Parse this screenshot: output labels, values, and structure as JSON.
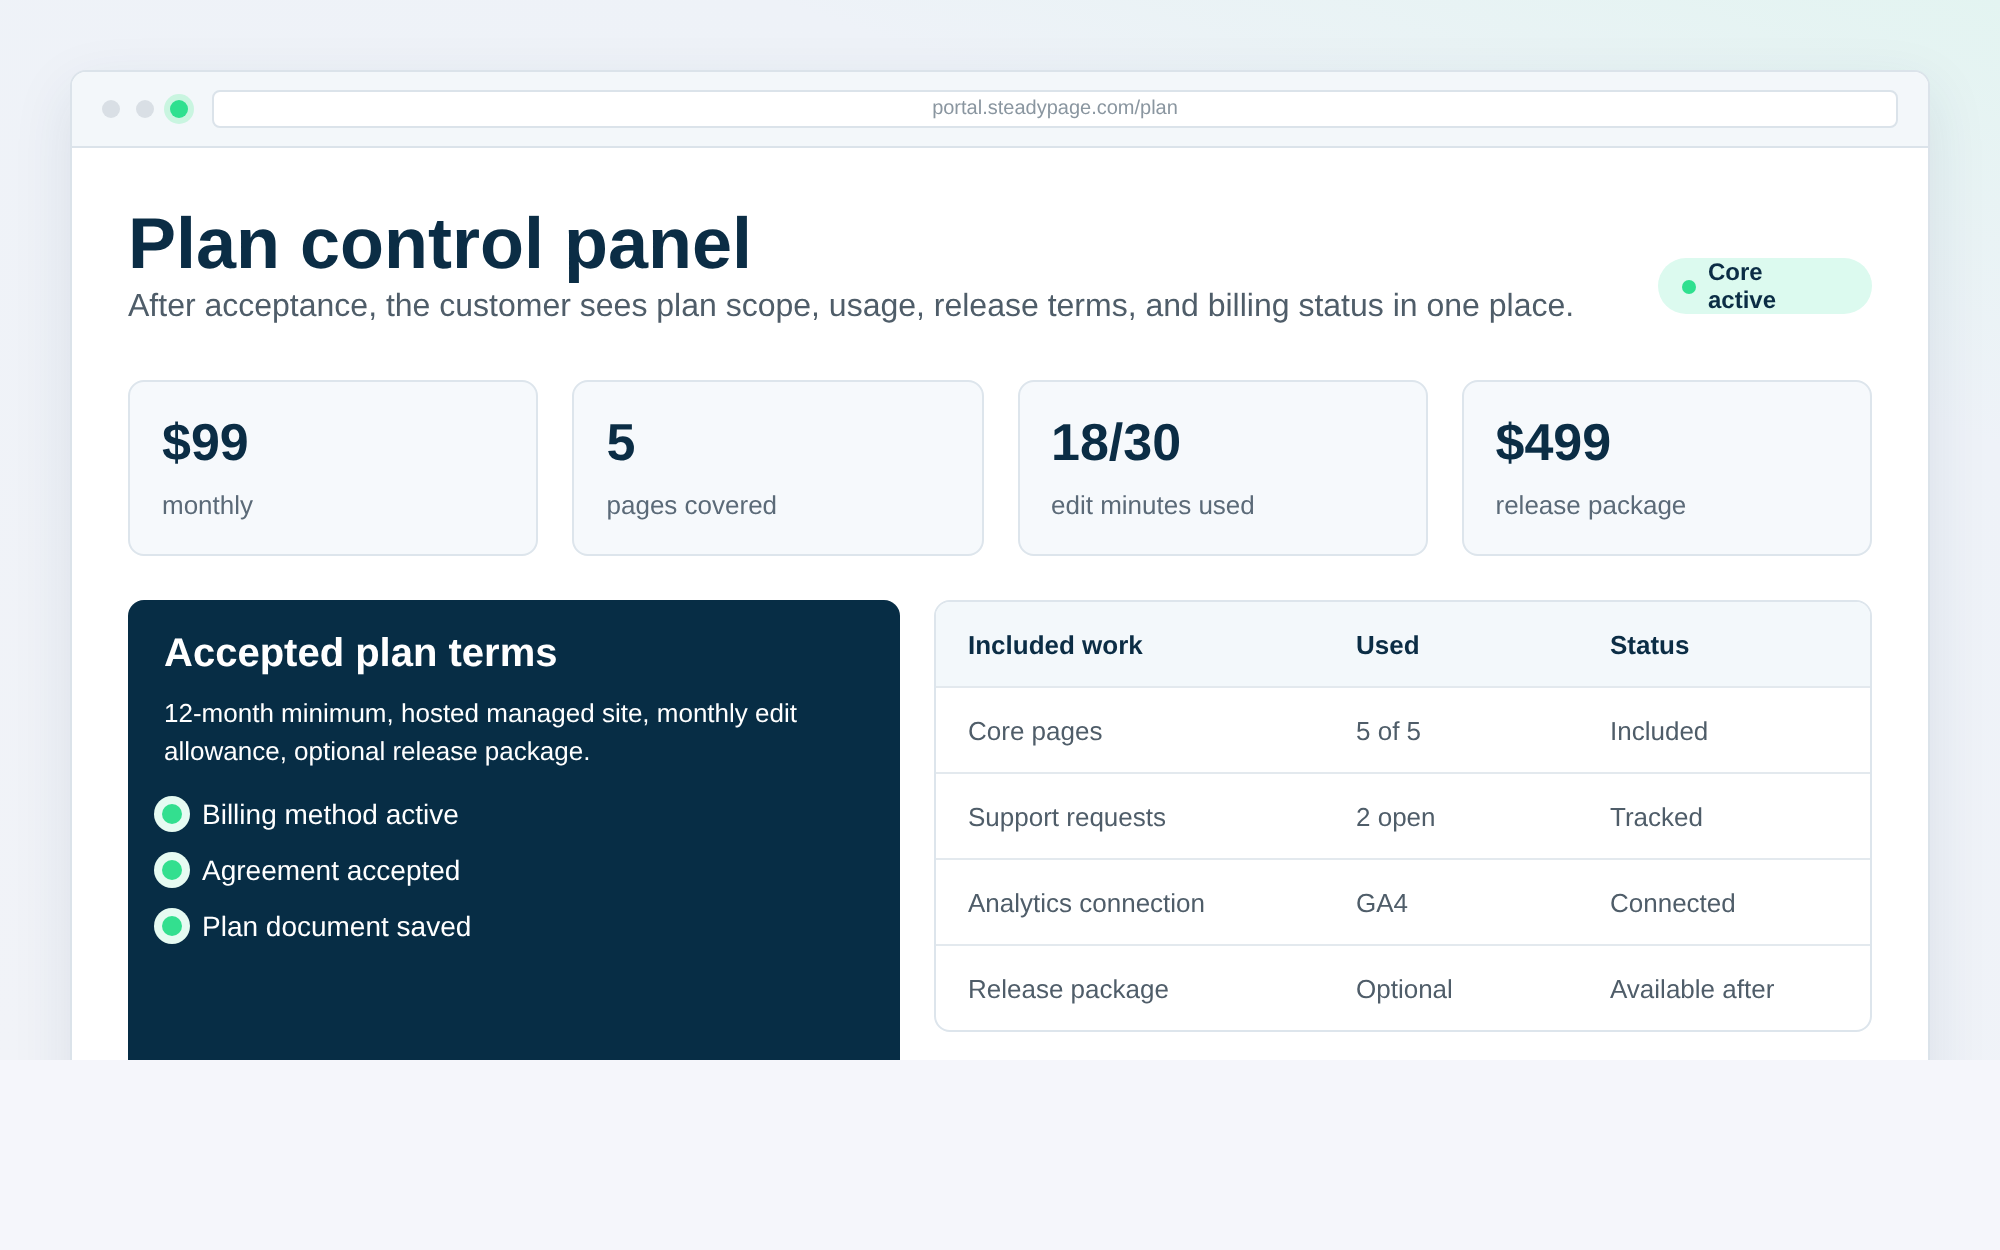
{
  "browser": {
    "address": "portal.steadypage.com/plan"
  },
  "header": {
    "title": "Plan control panel",
    "subtitle": "After acceptance, the customer sees plan scope, usage, release terms, and billing status in one place.",
    "badge": "Core active"
  },
  "stats": [
    {
      "value": "$99",
      "label": "monthly"
    },
    {
      "value": "5",
      "label": "pages covered"
    },
    {
      "value": "18/30",
      "label": "edit minutes used"
    },
    {
      "value": "$499",
      "label": "release package"
    }
  ],
  "terms": {
    "title": "Accepted plan terms",
    "description": "12-month minimum, hosted managed site, monthly edit allowance, optional release package.",
    "checklist": [
      "Billing method active",
      "Agreement accepted",
      "Plan document saved"
    ]
  },
  "table": {
    "columns": [
      "Included work",
      "Used",
      "Status"
    ],
    "rows": [
      [
        "Core pages",
        "5 of 5",
        "Included"
      ],
      [
        "Support requests",
        "2 open",
        "Tracked"
      ],
      [
        "Analytics connection",
        "GA4",
        "Connected"
      ],
      [
        "Release package",
        "Optional",
        "Available after"
      ]
    ]
  }
}
